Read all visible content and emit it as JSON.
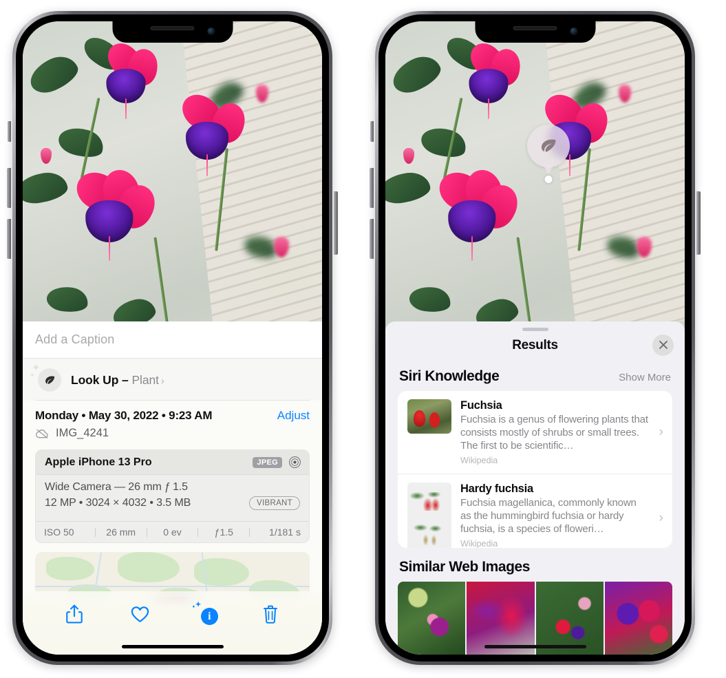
{
  "left_phone": {
    "caption": {
      "placeholder": "Add a Caption",
      "value": ""
    },
    "lookup": {
      "icon": "leaf-icon",
      "label_main": "Look Up – ",
      "label_sub": "Plant",
      "chevron": "›"
    },
    "meta": {
      "date": "Monday • May 30, 2022 • 9:23 AM",
      "adjust": "Adjust",
      "cloud_icon": "icloud-slash-icon",
      "filename": "IMG_4241"
    },
    "exif": {
      "device": "Apple iPhone 13 Pro",
      "format_chip": "JPEG",
      "lens_icon": "aperture-icon",
      "lens_line": "Wide Camera — 26 mm ƒ 1.5",
      "size_line": "12 MP • 3024 × 4032 • 3.5 MB",
      "style_chip": "VIBRANT",
      "stats": [
        "ISO 50",
        "26 mm",
        "0 ev",
        "ƒ1.5",
        "1/181 s"
      ]
    },
    "toolbar": [
      {
        "name": "share-icon",
        "label": "Share"
      },
      {
        "name": "heart-icon",
        "label": "Favorite"
      },
      {
        "name": "info-icon",
        "label": "Info"
      },
      {
        "name": "trash-icon",
        "label": "Delete"
      }
    ]
  },
  "right_phone": {
    "bubble": {
      "icon": "leaf-icon"
    },
    "header": {
      "title": "Results",
      "close_icon": "close-icon"
    },
    "siri_knowledge": {
      "title": "Siri Knowledge",
      "show_more": "Show More",
      "cards": [
        {
          "title": "Fuchsia",
          "desc": "Fuchsia is a genus of flowering plants that consists mostly of shrubs or small trees. The first to be scientific…",
          "source": "Wikipedia",
          "chevron": "›"
        },
        {
          "title": "Hardy fuchsia",
          "desc": "Fuchsia magellanica, commonly known as the hummingbird fuchsia or hardy fuchsia, is a species of floweri…",
          "source": "Wikipedia",
          "chevron": "›"
        }
      ]
    },
    "similar_web_images": {
      "title": "Similar Web Images",
      "items": [
        "web-image-1",
        "web-image-2",
        "web-image-3",
        "web-image-4"
      ]
    }
  },
  "colors": {
    "accent_blue": "#0a84ff",
    "sheet_bg": "#f1f1f5",
    "info_bg": "#fbfbf8",
    "text_primary": "#0b0b0d",
    "text_secondary": "#86868b"
  }
}
